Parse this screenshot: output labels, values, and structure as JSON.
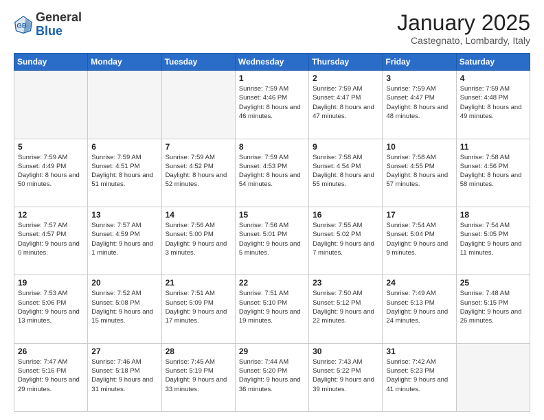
{
  "header": {
    "logo_general": "General",
    "logo_blue": "Blue",
    "month_title": "January 2025",
    "location": "Castegnato, Lombardy, Italy"
  },
  "days_of_week": [
    "Sunday",
    "Monday",
    "Tuesday",
    "Wednesday",
    "Thursday",
    "Friday",
    "Saturday"
  ],
  "weeks": [
    [
      {
        "num": "",
        "info": ""
      },
      {
        "num": "",
        "info": ""
      },
      {
        "num": "",
        "info": ""
      },
      {
        "num": "1",
        "info": "Sunrise: 7:59 AM\nSunset: 4:46 PM\nDaylight: 8 hours and 46 minutes."
      },
      {
        "num": "2",
        "info": "Sunrise: 7:59 AM\nSunset: 4:47 PM\nDaylight: 8 hours and 47 minutes."
      },
      {
        "num": "3",
        "info": "Sunrise: 7:59 AM\nSunset: 4:47 PM\nDaylight: 8 hours and 48 minutes."
      },
      {
        "num": "4",
        "info": "Sunrise: 7:59 AM\nSunset: 4:48 PM\nDaylight: 8 hours and 49 minutes."
      }
    ],
    [
      {
        "num": "5",
        "info": "Sunrise: 7:59 AM\nSunset: 4:49 PM\nDaylight: 8 hours and 50 minutes."
      },
      {
        "num": "6",
        "info": "Sunrise: 7:59 AM\nSunset: 4:51 PM\nDaylight: 8 hours and 51 minutes."
      },
      {
        "num": "7",
        "info": "Sunrise: 7:59 AM\nSunset: 4:52 PM\nDaylight: 8 hours and 52 minutes."
      },
      {
        "num": "8",
        "info": "Sunrise: 7:59 AM\nSunset: 4:53 PM\nDaylight: 8 hours and 54 minutes."
      },
      {
        "num": "9",
        "info": "Sunrise: 7:58 AM\nSunset: 4:54 PM\nDaylight: 8 hours and 55 minutes."
      },
      {
        "num": "10",
        "info": "Sunrise: 7:58 AM\nSunset: 4:55 PM\nDaylight: 8 hours and 57 minutes."
      },
      {
        "num": "11",
        "info": "Sunrise: 7:58 AM\nSunset: 4:56 PM\nDaylight: 8 hours and 58 minutes."
      }
    ],
    [
      {
        "num": "12",
        "info": "Sunrise: 7:57 AM\nSunset: 4:57 PM\nDaylight: 9 hours and 0 minutes."
      },
      {
        "num": "13",
        "info": "Sunrise: 7:57 AM\nSunset: 4:59 PM\nDaylight: 9 hours and 1 minute."
      },
      {
        "num": "14",
        "info": "Sunrise: 7:56 AM\nSunset: 5:00 PM\nDaylight: 9 hours and 3 minutes."
      },
      {
        "num": "15",
        "info": "Sunrise: 7:56 AM\nSunset: 5:01 PM\nDaylight: 9 hours and 5 minutes."
      },
      {
        "num": "16",
        "info": "Sunrise: 7:55 AM\nSunset: 5:02 PM\nDaylight: 9 hours and 7 minutes."
      },
      {
        "num": "17",
        "info": "Sunrise: 7:54 AM\nSunset: 5:04 PM\nDaylight: 9 hours and 9 minutes."
      },
      {
        "num": "18",
        "info": "Sunrise: 7:54 AM\nSunset: 5:05 PM\nDaylight: 9 hours and 11 minutes."
      }
    ],
    [
      {
        "num": "19",
        "info": "Sunrise: 7:53 AM\nSunset: 5:06 PM\nDaylight: 9 hours and 13 minutes."
      },
      {
        "num": "20",
        "info": "Sunrise: 7:52 AM\nSunset: 5:08 PM\nDaylight: 9 hours and 15 minutes."
      },
      {
        "num": "21",
        "info": "Sunrise: 7:51 AM\nSunset: 5:09 PM\nDaylight: 9 hours and 17 minutes."
      },
      {
        "num": "22",
        "info": "Sunrise: 7:51 AM\nSunset: 5:10 PM\nDaylight: 9 hours and 19 minutes."
      },
      {
        "num": "23",
        "info": "Sunrise: 7:50 AM\nSunset: 5:12 PM\nDaylight: 9 hours and 22 minutes."
      },
      {
        "num": "24",
        "info": "Sunrise: 7:49 AM\nSunset: 5:13 PM\nDaylight: 9 hours and 24 minutes."
      },
      {
        "num": "25",
        "info": "Sunrise: 7:48 AM\nSunset: 5:15 PM\nDaylight: 9 hours and 26 minutes."
      }
    ],
    [
      {
        "num": "26",
        "info": "Sunrise: 7:47 AM\nSunset: 5:16 PM\nDaylight: 9 hours and 29 minutes."
      },
      {
        "num": "27",
        "info": "Sunrise: 7:46 AM\nSunset: 5:18 PM\nDaylight: 9 hours and 31 minutes."
      },
      {
        "num": "28",
        "info": "Sunrise: 7:45 AM\nSunset: 5:19 PM\nDaylight: 9 hours and 33 minutes."
      },
      {
        "num": "29",
        "info": "Sunrise: 7:44 AM\nSunset: 5:20 PM\nDaylight: 9 hours and 36 minutes."
      },
      {
        "num": "30",
        "info": "Sunrise: 7:43 AM\nSunset: 5:22 PM\nDaylight: 9 hours and 39 minutes."
      },
      {
        "num": "31",
        "info": "Sunrise: 7:42 AM\nSunset: 5:23 PM\nDaylight: 9 hours and 41 minutes."
      },
      {
        "num": "",
        "info": ""
      }
    ]
  ]
}
